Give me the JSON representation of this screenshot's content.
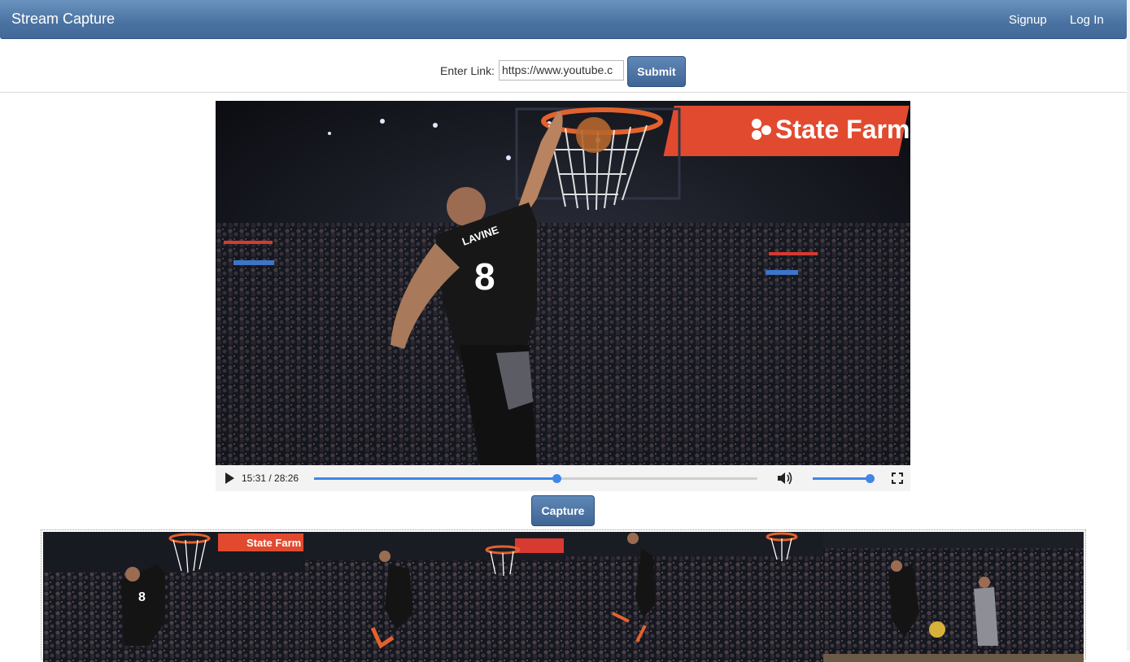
{
  "navbar": {
    "brand": "Stream Capture",
    "links": [
      {
        "label": "Signup"
      },
      {
        "label": "Log In"
      }
    ]
  },
  "link_form": {
    "label": "Enter Link:",
    "input_value": "https://www.youtube.c",
    "submit_label": "Submit"
  },
  "video": {
    "scene_text": {
      "sponsor": "State Farm",
      "jersey_name": "LAVINE",
      "jersey_number": "8"
    },
    "current_time": "15:31",
    "duration": "28:26",
    "progress_fraction": 0.546,
    "volume_fraction": 0.93
  },
  "capture_button_label": "Capture",
  "captures": [
    {
      "sponsor": "State Farm",
      "jersey_number": "8"
    },
    {
      "sponsor": "",
      "jersey_number": ""
    },
    {
      "sponsor": "",
      "jersey_number": ""
    },
    {
      "sponsor": "",
      "jersey_number": ""
    }
  ],
  "colors": {
    "navbar": "#4a72a0",
    "accent": "#3f86e8",
    "sponsor_red": "#e14a2f"
  }
}
